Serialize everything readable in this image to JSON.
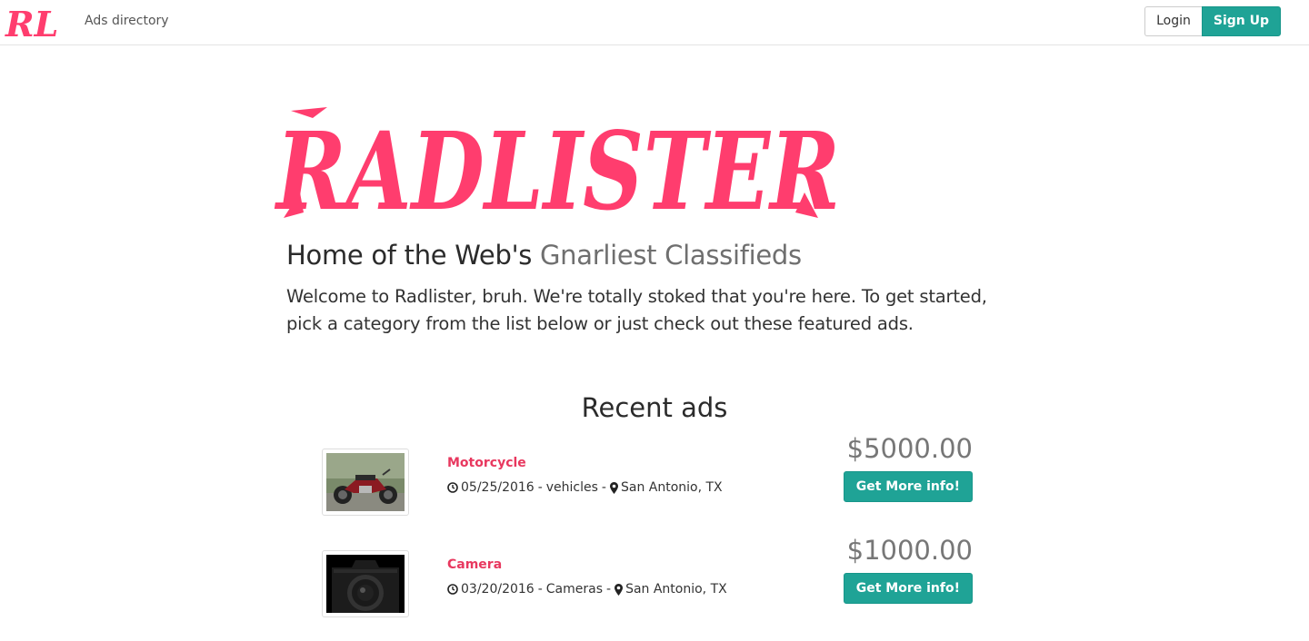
{
  "navbar": {
    "brand": "RL",
    "nav_link": "Ads directory",
    "login_label": "Login",
    "signup_label": "Sign Up"
  },
  "hero": {
    "logo_text": "Radlister",
    "title_main": "Home of the Web's ",
    "title_muted": "Gnarliest Classifieds",
    "intro": "Welcome to Radlister, bruh. We're totally stoked that you're here. To get started, pick a category from the list below or just check out these featured ads."
  },
  "recent": {
    "heading": "Recent ads",
    "ads": [
      {
        "title": "Motorcycle",
        "date": "05/25/2016",
        "category": "vehicles",
        "location": "San Antonio, TX",
        "price": "$5000.00",
        "button": "Get More info!"
      },
      {
        "title": "Camera",
        "date": "03/20/2016",
        "category": "Cameras",
        "location": "San Antonio, TX",
        "price": "$1000.00",
        "button": "Get More info!"
      }
    ]
  },
  "colors": {
    "brand_pink": "#ff3d6e",
    "accent_teal": "#1fa396",
    "link_red": "#e8385f"
  },
  "icons": [
    "clock-icon",
    "map-marker-icon"
  ]
}
